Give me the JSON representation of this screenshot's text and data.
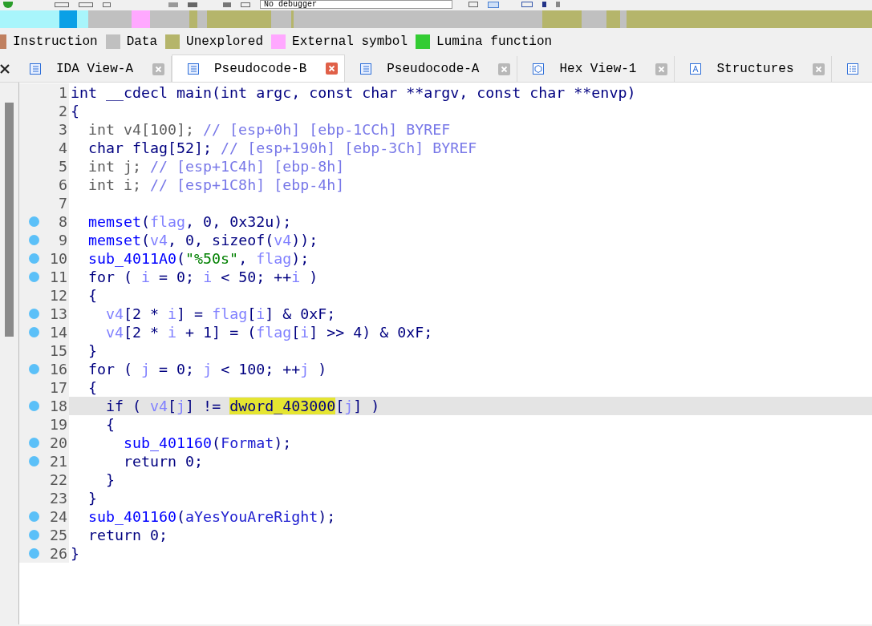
{
  "toolbar": {
    "debugger_select": "No debugger"
  },
  "legend": [
    {
      "label": "Instruction",
      "color": "#c08060"
    },
    {
      "label": "Data",
      "color": "#c0c0c0"
    },
    {
      "label": "Unexplored",
      "color": "#b5b56b"
    },
    {
      "label": "External symbol",
      "color": "#ffa8ff"
    },
    {
      "label": "Lumina function",
      "color": "#33cc33"
    }
  ],
  "tabs": [
    {
      "label": "IDA View-A",
      "kind": "listing",
      "selected": false
    },
    {
      "label": "Pseudocode-B",
      "kind": "listing",
      "selected": true
    },
    {
      "label": "Pseudocode-A",
      "kind": "listing",
      "selected": false
    },
    {
      "label": "Hex View-1",
      "kind": "hex",
      "selected": false
    },
    {
      "label": "Structures",
      "kind": "struct",
      "selected": false
    },
    {
      "kind": "list",
      "selected": false
    }
  ],
  "code": [
    {
      "number": "1",
      "marker": false,
      "selected": false,
      "tokens": [
        {
          "text": "int __cdecl main(int argc, const char **argv, const char **envp)",
          "kind": "code"
        }
      ]
    },
    {
      "number": "2",
      "marker": false,
      "selected": false,
      "tokens": [
        {
          "text": "{",
          "kind": "code"
        }
      ]
    },
    {
      "number": "3",
      "marker": false,
      "selected": false,
      "tokens": [
        {
          "text": "  int v4[100]; ",
          "kind": "dim"
        },
        {
          "text": "// [esp+0h] [ebp-1CCh] BYREF",
          "kind": "comment"
        }
      ]
    },
    {
      "number": "4",
      "marker": false,
      "selected": false,
      "tokens": [
        {
          "text": "  char flag[52]; ",
          "kind": "code"
        },
        {
          "text": "// [esp+190h] [ebp-3Ch] BYREF",
          "kind": "comment"
        }
      ]
    },
    {
      "number": "5",
      "marker": false,
      "selected": false,
      "tokens": [
        {
          "text": "  int j; ",
          "kind": "dim"
        },
        {
          "text": "// [esp+1C4h] [ebp-8h]",
          "kind": "comment"
        }
      ]
    },
    {
      "number": "6",
      "marker": false,
      "selected": false,
      "tokens": [
        {
          "text": "  int i; ",
          "kind": "dim"
        },
        {
          "text": "// [esp+1C8h] [ebp-4h]",
          "kind": "comment"
        }
      ]
    },
    {
      "number": "7",
      "marker": false,
      "selected": false
    },
    {
      "number": "8",
      "marker": true,
      "selected": false,
      "tokens": [
        {
          "text": "  memset",
          "kind": "fn"
        },
        {
          "text": "(",
          "kind": "code"
        },
        {
          "text": "flag",
          "kind": "var"
        },
        {
          "text": ", 0, 0x32u);",
          "kind": "code"
        }
      ]
    },
    {
      "number": "9",
      "marker": true,
      "selected": false,
      "tokens": [
        {
          "text": "  memset",
          "kind": "fn"
        },
        {
          "text": "(",
          "kind": "code"
        },
        {
          "text": "v4",
          "kind": "var"
        },
        {
          "text": ", 0, sizeof(",
          "kind": "code"
        },
        {
          "text": "v4",
          "kind": "var"
        },
        {
          "text": "));",
          "kind": "code"
        }
      ]
    },
    {
      "number": "10",
      "marker": true,
      "selected": false,
      "tokens": [
        {
          "text": "  sub_4011A0",
          "kind": "fn"
        },
        {
          "text": "(",
          "kind": "code"
        },
        {
          "text": "\"%50s\"",
          "kind": "str"
        },
        {
          "text": ", ",
          "kind": "code"
        },
        {
          "text": "flag",
          "kind": "var"
        },
        {
          "text": ");",
          "kind": "code"
        }
      ]
    },
    {
      "number": "11",
      "marker": true,
      "selected": false,
      "tokens": [
        {
          "text": "  for ( ",
          "kind": "code"
        },
        {
          "text": "i",
          "kind": "var"
        },
        {
          "text": " = 0; ",
          "kind": "code"
        },
        {
          "text": "i",
          "kind": "var"
        },
        {
          "text": " < 50; ++",
          "kind": "code"
        },
        {
          "text": "i",
          "kind": "var"
        },
        {
          "text": " )",
          "kind": "code"
        }
      ]
    },
    {
      "number": "12",
      "marker": false,
      "selected": false,
      "tokens": [
        {
          "text": "  {",
          "kind": "code"
        }
      ]
    },
    {
      "number": "13",
      "marker": true,
      "selected": false,
      "tokens": [
        {
          "text": "    v4",
          "kind": "var"
        },
        {
          "text": "[2 * ",
          "kind": "code"
        },
        {
          "text": "i",
          "kind": "var"
        },
        {
          "text": "] = ",
          "kind": "code"
        },
        {
          "text": "flag",
          "kind": "var"
        },
        {
          "text": "[",
          "kind": "code"
        },
        {
          "text": "i",
          "kind": "var"
        },
        {
          "text": "] & 0xF;",
          "kind": "code"
        }
      ]
    },
    {
      "number": "14",
      "marker": true,
      "selected": false,
      "tokens": [
        {
          "text": "    v4",
          "kind": "var"
        },
        {
          "text": "[2 * ",
          "kind": "code"
        },
        {
          "text": "i",
          "kind": "var"
        },
        {
          "text": " + 1] = (",
          "kind": "code"
        },
        {
          "text": "flag",
          "kind": "var"
        },
        {
          "text": "[",
          "kind": "code"
        },
        {
          "text": "i",
          "kind": "var"
        },
        {
          "text": "] >> 4) & 0xF;",
          "kind": "code"
        }
      ]
    },
    {
      "number": "15",
      "marker": false,
      "selected": false,
      "tokens": [
        {
          "text": "  }",
          "kind": "code"
        }
      ]
    },
    {
      "number": "16",
      "marker": true,
      "selected": false,
      "tokens": [
        {
          "text": "  for ( ",
          "kind": "code"
        },
        {
          "text": "j",
          "kind": "var"
        },
        {
          "text": " = 0; ",
          "kind": "code"
        },
        {
          "text": "j",
          "kind": "var"
        },
        {
          "text": " < 100; ++",
          "kind": "code"
        },
        {
          "text": "j",
          "kind": "var"
        },
        {
          "text": " )",
          "kind": "code"
        }
      ]
    },
    {
      "number": "17",
      "marker": false,
      "selected": false,
      "tokens": [
        {
          "text": "  {",
          "kind": "code"
        }
      ]
    },
    {
      "number": "18",
      "marker": true,
      "selected": true,
      "tokens": [
        {
          "text": "    if ( ",
          "kind": "code"
        },
        {
          "text": "v4",
          "kind": "var"
        },
        {
          "text": "[",
          "kind": "code"
        },
        {
          "text": "j",
          "kind": "var"
        },
        {
          "text": "] != ",
          "kind": "code"
        },
        {
          "text": "dword_403000",
          "kind": "highlight"
        },
        {
          "text": "[",
          "kind": "code"
        },
        {
          "text": "j",
          "kind": "var"
        },
        {
          "text": "] )",
          "kind": "code"
        }
      ]
    },
    {
      "number": "19",
      "marker": false,
      "selected": false,
      "tokens": [
        {
          "text": "    {",
          "kind": "code"
        }
      ]
    },
    {
      "number": "20",
      "marker": true,
      "selected": false,
      "tokens": [
        {
          "text": "      sub_401160",
          "kind": "fn"
        },
        {
          "text": "(",
          "kind": "code"
        },
        {
          "text": "Format",
          "kind": "global"
        },
        {
          "text": ");",
          "kind": "code"
        }
      ]
    },
    {
      "number": "21",
      "marker": true,
      "selected": false,
      "tokens": [
        {
          "text": "      return 0;",
          "kind": "code"
        }
      ]
    },
    {
      "number": "22",
      "marker": false,
      "selected": false,
      "tokens": [
        {
          "text": "    }",
          "kind": "code"
        }
      ]
    },
    {
      "number": "23",
      "marker": false,
      "selected": false,
      "tokens": [
        {
          "text": "  }",
          "kind": "code"
        }
      ]
    },
    {
      "number": "24",
      "marker": true,
      "selected": false,
      "tokens": [
        {
          "text": "  sub_401160",
          "kind": "fn"
        },
        {
          "text": "(",
          "kind": "code"
        },
        {
          "text": "aYesYouAreRight",
          "kind": "global"
        },
        {
          "text": ");",
          "kind": "code"
        }
      ]
    },
    {
      "number": "25",
      "marker": true,
      "selected": false,
      "tokens": [
        {
          "text": "  return 0;",
          "kind": "code"
        }
      ]
    },
    {
      "number": "26",
      "marker": true,
      "selected": false,
      "tokens": [
        {
          "text": "}",
          "kind": "code"
        }
      ]
    }
  ]
}
